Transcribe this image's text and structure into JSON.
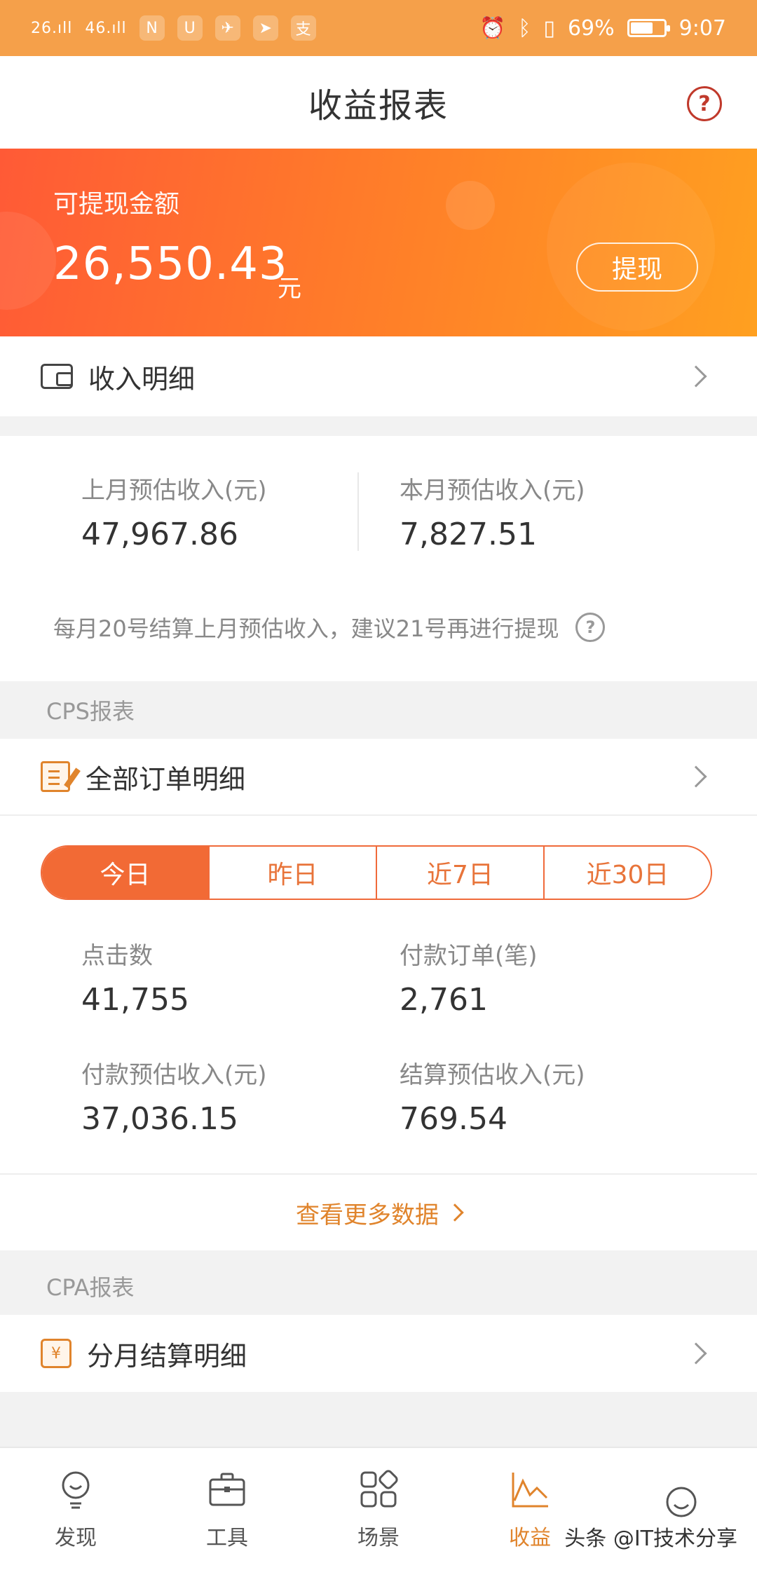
{
  "status_bar": {
    "signal_1": "26.ıll",
    "signal_2": "46.ıll",
    "battery": "69%",
    "time": "9:07",
    "battery_level": 0.69
  },
  "header": {
    "title": "收益报表",
    "help_label": "?"
  },
  "balance": {
    "label": "可提现金额",
    "amount": "26,550.43",
    "unit": "元",
    "withdraw_label": "提现"
  },
  "income_detail": {
    "label": "收入明细"
  },
  "estimates": {
    "last_month_label": "上月预估收入(元)",
    "last_month_value": "47,967.86",
    "this_month_label": "本月预估收入(元)",
    "this_month_value": "7,827.51",
    "note": "每月20号结算上月预估收入，建议21号再进行提现",
    "note_help": "?"
  },
  "cps": {
    "section_title": "CPS报表",
    "orders_label": "全部订单明细",
    "tabs": [
      {
        "label": "今日",
        "active": true
      },
      {
        "label": "昨日",
        "active": false
      },
      {
        "label": "近7日",
        "active": false
      },
      {
        "label": "近30日",
        "active": false
      }
    ],
    "metrics": {
      "clicks_label": "点击数",
      "clicks_value": "41,755",
      "paid_orders_label": "付款订单(笔)",
      "paid_orders_value": "2,761",
      "paid_income_label": "付款预估收入(元)",
      "paid_income_value": "37,036.15",
      "settled_income_label": "结算预估收入(元)",
      "settled_income_value": "769.54"
    },
    "more_label": "查看更多数据"
  },
  "cpa": {
    "section_title": "CPA报表",
    "monthly_label": "分月结算明细",
    "bill_icon_text": "¥"
  },
  "tab_bar": {
    "items": [
      {
        "label": "发现",
        "icon": "bulb-icon",
        "active": false
      },
      {
        "label": "工具",
        "icon": "briefcase-icon",
        "active": false
      },
      {
        "label": "场景",
        "icon": "grid-icon",
        "active": false
      },
      {
        "label": "收益",
        "icon": "chart-icon",
        "active": true
      },
      {
        "label": "",
        "icon": "smile-icon",
        "active": false
      }
    ]
  },
  "watermark": "头条 @IT技术分享",
  "colors": {
    "status_bar": "#f5a04a",
    "accent": "#f26a35",
    "gold": "#e0842c"
  }
}
